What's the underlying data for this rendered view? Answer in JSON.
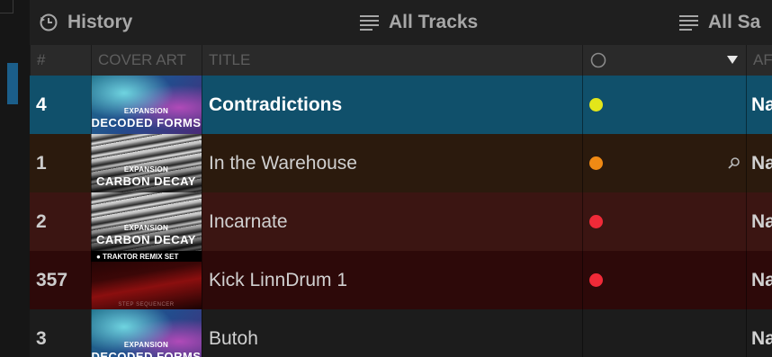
{
  "header": {
    "history_label": "History",
    "all_tracks_label": "All Tracks",
    "all_samples_label": "All Sa"
  },
  "columns": {
    "number": "#",
    "cover_art": "COVER ART",
    "title": "TITLE",
    "color_indicator_icon": "circle-icon",
    "sort_icon": "triangle-down-icon",
    "artist": "AF"
  },
  "rows": [
    {
      "number": "4",
      "title": "Contradictions",
      "dot_color": "#e3e61a",
      "artist": "Na",
      "row_bg": "#10506b",
      "number_color": "#ffffff",
      "title_color": "#ffffff",
      "artist_color": "#ffffff",
      "selected": true,
      "cover": {
        "type": "decoded",
        "line1": "EXPANSION",
        "line2": "DECODED FORMS"
      }
    },
    {
      "number": "1",
      "title": "In the Warehouse",
      "dot_color": "#f08a14",
      "artist": "Na",
      "row_bg": "#2b1a0d",
      "number_color": "#cccccc",
      "title_color": "#d0d0d0",
      "artist_color": "#d0d0d0",
      "selected": false,
      "search_icon": true,
      "cover": {
        "type": "carbon",
        "line1": "EXPANSION",
        "line2": "CARBON DECAY"
      }
    },
    {
      "number": "2",
      "title": "Incarnate",
      "dot_color": "#f02a38",
      "artist": "Na",
      "row_bg": "#3b1512",
      "number_color": "#cccccc",
      "title_color": "#d0d0d0",
      "artist_color": "#d0d0d0",
      "selected": false,
      "cover": {
        "type": "carbon",
        "line1": "EXPANSION",
        "line2": "CARBON DECAY"
      }
    },
    {
      "number": "357",
      "title": "Kick LinnDrum 1",
      "dot_color": "#f02a38",
      "artist": "Na",
      "row_bg": "#2d0909",
      "number_color": "#cccccc",
      "title_color": "#d0d0d0",
      "artist_color": "#d0d0d0",
      "selected": false,
      "cover": {
        "type": "traktor",
        "line1": "TRAKTOR REMIX SET",
        "line2": "STEP SEQUENCER"
      }
    },
    {
      "number": "3",
      "title": "Butoh",
      "dot_color": "",
      "artist": "Na",
      "row_bg": "#1c1c1c",
      "number_color": "#cccccc",
      "title_color": "#d0d0d0",
      "artist_color": "#d0d0d0",
      "selected": false,
      "cover": {
        "type": "decoded",
        "line1": "EXPANSION",
        "line2": "DECODED FORMS"
      }
    }
  ]
}
